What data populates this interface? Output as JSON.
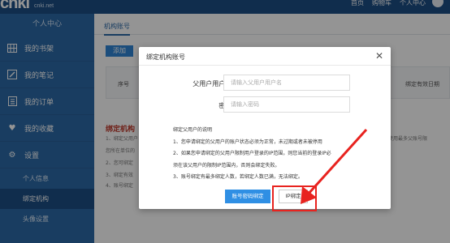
{
  "topbar": {
    "logo_text": "cnki",
    "logo_sub": "cnki.net",
    "nav": [
      "首页",
      "购物车",
      "个人中心"
    ]
  },
  "sidebar": {
    "header": "个人中心",
    "items": [
      {
        "label": "我的书架",
        "icon": "bookshelf-icon"
      },
      {
        "label": "我的笔记",
        "icon": "note-icon"
      },
      {
        "label": "我的订单",
        "icon": "order-icon"
      },
      {
        "label": "我的收藏",
        "icon": "heart-icon"
      },
      {
        "label": "设置",
        "icon": "gear-icon"
      }
    ],
    "sub_items": [
      "个人信息",
      "绑定机构",
      "头像设置"
    ]
  },
  "content": {
    "tab": "机构账号",
    "add_button": "添加",
    "table_col_1": "序号",
    "table_col_2": "绑定有效日期",
    "section_title": "绑定机构",
    "bg_lines": [
      "1、绑定父用户",
      "您所在单位的",
      "2、您可绑定",
      "3、绑定有效",
      "4、账号绑定"
    ],
    "bg_right": "但使用最多父账号限"
  },
  "modal": {
    "title": "绑定机构账号",
    "username_label": "父用户用户名:",
    "username_placeholder": "请输入父用户用户名",
    "password_label": "密码:",
    "password_placeholder": "请输入密码",
    "info_title": "绑定父用户的说明",
    "info_lines": [
      "1、您申请绑定的父用户的账户状态必须为正常，未过期或者未被停用",
      "2、如果您申请绑定的父用户限制用户登录的IP范围，则您当前的登录IP必",
      "须在该父用户的限制IP范围内，否则会绑定失败。",
      "3、账号绑定有最多绑定人数，若绑定人数已满，无法绑定。"
    ],
    "primary_button": "账号密码绑定",
    "ip_button": "IP绑定"
  },
  "colors": {
    "topbar": "#1d4f86",
    "sidebar": "#2b6aa8",
    "primary": "#2f8fe4",
    "annotation": "#e8231f"
  }
}
